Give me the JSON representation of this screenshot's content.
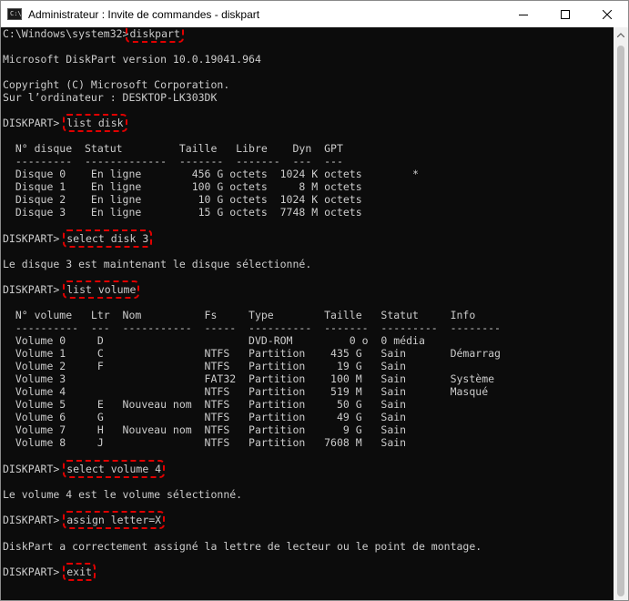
{
  "window": {
    "title": "Administrateur : Invite de commandes - diskpart",
    "icon": "C:\\"
  },
  "icons": {
    "app": "console-app-icon",
    "minimize": "minimize-icon",
    "maximize": "maximize-icon",
    "close": "close-icon"
  },
  "console": {
    "prompt_path": "C:\\Windows\\system32>",
    "prompt_diskpart": "DISKPART> ",
    "cmd1": "diskpart",
    "version": "Microsoft DiskPart version 10.0.19041.964",
    "copyright": "Copyright (C) Microsoft Corporation.",
    "computer": "Sur l’ordinateur : DESKTOP-LK303DK",
    "cmd2": "list disk",
    "disk_header": "  N° disque  Statut         Taille   Libre    Dyn  GPT",
    "disk_sep": "  ---------  -------------  -------  -------  ---  ---",
    "disk_rows": [
      "  Disque 0    En ligne        456 G octets  1024 K octets        *",
      "  Disque 1    En ligne        100 G octets     8 M octets",
      "  Disque 2    En ligne         10 G octets  1024 K octets",
      "  Disque 3    En ligne         15 G octets  7748 M octets"
    ],
    "cmd3": "select disk 3",
    "disk_selected": "Le disque 3 est maintenant le disque sélectionné.",
    "cmd4": "list volume",
    "vol_header": "  N° volume   Ltr  Nom          Fs     Type        Taille   Statut     Info",
    "vol_sep": "  ----------  ---  -----------  -----  ----------  -------  ---------  --------",
    "vol_rows": [
      "  Volume 0     D                       DVD-ROM         0 o  0 média",
      "  Volume 1     C                NTFS   Partition    435 G   Sain       Démarrag",
      "  Volume 2     F                NTFS   Partition     19 G   Sain",
      "  Volume 3                      FAT32  Partition    100 M   Sain       Système",
      "  Volume 4                      NTFS   Partition    519 M   Sain       Masqué",
      "  Volume 5     E   Nouveau nom  NTFS   Partition     50 G   Sain",
      "  Volume 6     G                NTFS   Partition     49 G   Sain",
      "  Volume 7     H   Nouveau nom  NTFS   Partition      9 G   Sain",
      "  Volume 8     J                NTFS   Partition   7608 M   Sain"
    ],
    "cmd5": "select volume 4",
    "vol_selected": "Le volume 4 est le volume sélectionné.",
    "cmd6": "assign letter=X",
    "assign_result": "DiskPart a correctement assigné la lettre de lecteur ou le point de montage.",
    "cmd7": "exit"
  },
  "colors": {
    "console_bg": "#0c0c0c",
    "console_text": "#cccccc",
    "highlight": "#e00000"
  }
}
